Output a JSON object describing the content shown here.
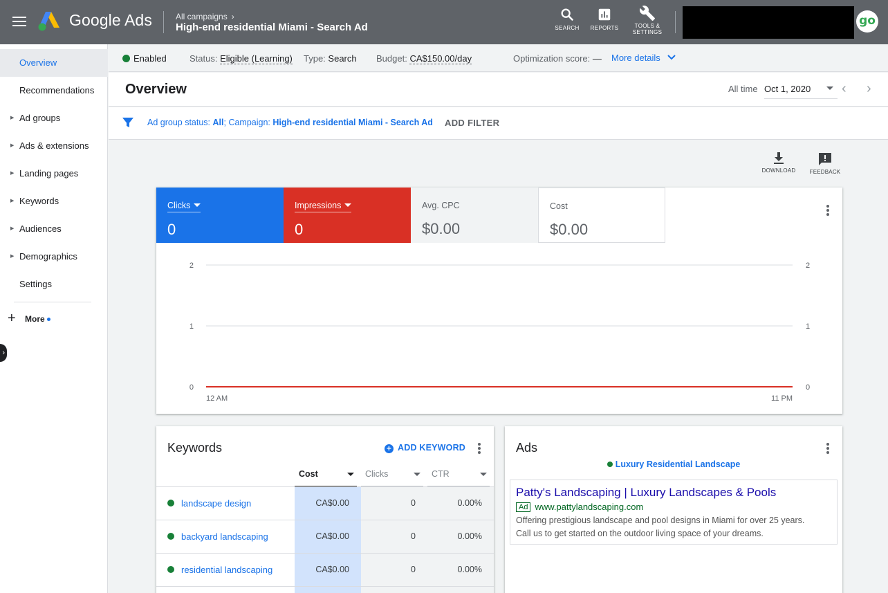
{
  "topbar": {
    "brand": "Google Ads",
    "breadcrumb": "All campaigns",
    "campaign": "High-end residential Miami - Search Ad",
    "icons": [
      {
        "label": "SEARCH",
        "icon": "search-icon"
      },
      {
        "label": "REPORTS",
        "icon": "reports-icon"
      },
      {
        "label_line1": "TOOLS &",
        "label_line2": "SETTINGS",
        "icon": "wrench-icon"
      }
    ],
    "avatar": "go"
  },
  "sidebar": {
    "items": [
      {
        "label": "Overview",
        "active": true,
        "expandable": false
      },
      {
        "label": "Recommendations",
        "active": false,
        "expandable": false
      },
      {
        "label": "Ad groups",
        "active": false,
        "expandable": true
      },
      {
        "label": "Ads & extensions",
        "active": false,
        "expandable": true
      },
      {
        "label": "Landing pages",
        "active": false,
        "expandable": true
      },
      {
        "label": "Keywords",
        "active": false,
        "expandable": true
      },
      {
        "label": "Audiences",
        "active": false,
        "expandable": true
      },
      {
        "label": "Demographics",
        "active": false,
        "expandable": true
      },
      {
        "label": "Settings",
        "active": false,
        "expandable": false
      }
    ],
    "more": "More"
  },
  "statusbar": {
    "enabled": "Enabled",
    "status_label": "Status:",
    "status_value": "Eligible (Learning)",
    "type_label": "Type:",
    "type_value": "Search",
    "budget_label": "Budget:",
    "budget_value": "CA$150.00/day",
    "opt_label": "Optimization score:",
    "opt_value": "—",
    "more_details": "More details"
  },
  "overview": {
    "title": "Overview",
    "range_label": "All time",
    "date": "Oct 1, 2020"
  },
  "filter": {
    "prefix": "Ad group status: ",
    "status": "All",
    "mid": "; Campaign: ",
    "campaign": "High-end residential Miami - Search Ad",
    "add_filter": "ADD FILTER"
  },
  "actions": {
    "download": "DOWNLOAD",
    "feedback": "FEEDBACK"
  },
  "metrics": [
    {
      "label": "Clicks",
      "value": "0",
      "color": "#1a73e8"
    },
    {
      "label": "Impressions",
      "value": "0",
      "color": "#d93025"
    },
    {
      "label": "Avg. CPC",
      "value": "$0.00"
    },
    {
      "label": "Cost",
      "value": "$0.00"
    }
  ],
  "chart_data": {
    "type": "line",
    "x": [
      "12 AM",
      "11 PM"
    ],
    "series": [
      {
        "values": [
          0,
          0
        ],
        "color": "#1a73e8"
      },
      {
        "values": [
          0,
          0
        ],
        "color": "#d93025"
      }
    ],
    "y_ticks": [
      "0",
      "1",
      "2"
    ],
    "ylim": [
      0,
      2
    ],
    "grid": true
  },
  "keywords": {
    "title": "Keywords",
    "add_label": "ADD KEYWORD",
    "columns": [
      "Cost",
      "Clicks",
      "CTR"
    ],
    "rows": [
      {
        "keyword": "landscape design",
        "cost": "CA$0.00",
        "clicks": "0",
        "ctr": "0.00%"
      },
      {
        "keyword": "backyard landscaping",
        "cost": "CA$0.00",
        "clicks": "0",
        "ctr": "0.00%"
      },
      {
        "keyword": "residential landscaping",
        "cost": "CA$0.00",
        "clicks": "0",
        "ctr": "0.00%"
      }
    ]
  },
  "ads": {
    "title": "Ads",
    "ad_group": "Luxury Residential Landscape",
    "headline": "Patty's Landscaping | Luxury Landscapes & Pools",
    "badge": "Ad",
    "url": "www.pattylandscaping.com",
    "description_line1": "Offering prestigious landscape and pool designs in Miami for over 25 years.",
    "description_line2": "Call us to get started on the outdoor living space of your dreams."
  }
}
